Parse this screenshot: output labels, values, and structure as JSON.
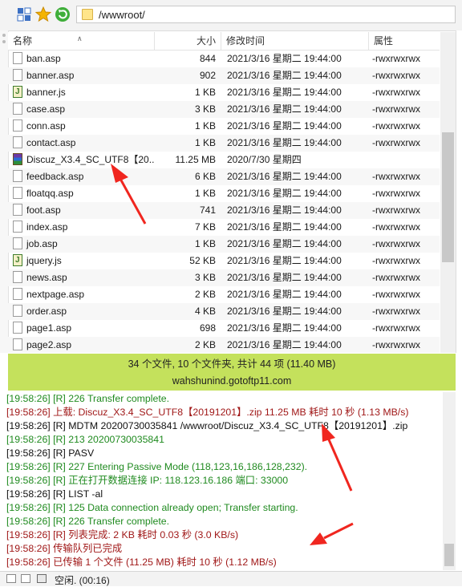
{
  "toolbar": {
    "path": "/wwwroot/"
  },
  "columns": {
    "name": "名称",
    "size": "大小",
    "modified": "修改时间",
    "attr": "属性"
  },
  "files": [
    {
      "name": "ban.asp",
      "size": "844",
      "date": "2021/3/16 星期二 19:44:00",
      "attr": "-rwxrwxrwx",
      "icon": "file-icon"
    },
    {
      "name": "banner.asp",
      "size": "902",
      "date": "2021/3/16 星期二 19:44:00",
      "attr": "-rwxrwxrwx",
      "icon": "file-icon"
    },
    {
      "name": "banner.js",
      "size": "1 KB",
      "date": "2021/3/16 星期二 19:44:00",
      "attr": "-rwxrwxrwx",
      "icon": "js-file-icon"
    },
    {
      "name": "case.asp",
      "size": "3 KB",
      "date": "2021/3/16 星期二 19:44:00",
      "attr": "-rwxrwxrwx",
      "icon": "file-icon"
    },
    {
      "name": "conn.asp",
      "size": "1 KB",
      "date": "2021/3/16 星期二 19:44:00",
      "attr": "-rwxrwxrwx",
      "icon": "file-icon"
    },
    {
      "name": "contact.asp",
      "size": "1 KB",
      "date": "2021/3/16 星期二 19:44:00",
      "attr": "-rwxrwxrwx",
      "icon": "file-icon"
    },
    {
      "name": "Discuz_X3.4_SC_UTF8【20...",
      "size": "11.25 MB",
      "date": "2020/7/30 星期四",
      "attr": "",
      "icon": "archive-icon"
    },
    {
      "name": "feedback.asp",
      "size": "6 KB",
      "date": "2021/3/16 星期二 19:44:00",
      "attr": "-rwxrwxrwx",
      "icon": "file-icon"
    },
    {
      "name": "floatqq.asp",
      "size": "1 KB",
      "date": "2021/3/16 星期二 19:44:00",
      "attr": "-rwxrwxrwx",
      "icon": "file-icon"
    },
    {
      "name": "foot.asp",
      "size": "741",
      "date": "2021/3/16 星期二 19:44:00",
      "attr": "-rwxrwxrwx",
      "icon": "file-icon"
    },
    {
      "name": "index.asp",
      "size": "7 KB",
      "date": "2021/3/16 星期二 19:44:00",
      "attr": "-rwxrwxrwx",
      "icon": "file-icon"
    },
    {
      "name": "job.asp",
      "size": "1 KB",
      "date": "2021/3/16 星期二 19:44:00",
      "attr": "-rwxrwxrwx",
      "icon": "file-icon"
    },
    {
      "name": "jquery.js",
      "size": "52 KB",
      "date": "2021/3/16 星期二 19:44:00",
      "attr": "-rwxrwxrwx",
      "icon": "js-file-icon"
    },
    {
      "name": "news.asp",
      "size": "3 KB",
      "date": "2021/3/16 星期二 19:44:00",
      "attr": "-rwxrwxrwx",
      "icon": "file-icon"
    },
    {
      "name": "nextpage.asp",
      "size": "2 KB",
      "date": "2021/3/16 星期二 19:44:00",
      "attr": "-rwxrwxrwx",
      "icon": "file-icon"
    },
    {
      "name": "order.asp",
      "size": "4 KB",
      "date": "2021/3/16 星期二 19:44:00",
      "attr": "-rwxrwxrwx",
      "icon": "file-icon"
    },
    {
      "name": "page1.asp",
      "size": "698",
      "date": "2021/3/16 星期二 19:44:00",
      "attr": "-rwxrwxrwx",
      "icon": "file-icon"
    },
    {
      "name": "page2.asp",
      "size": "2 KB",
      "date": "2021/3/16 星期二 19:44:00",
      "attr": "-rwxrwxrwx",
      "icon": "file-icon"
    }
  ],
  "status": {
    "summary": "34 个文件, 10 个文件夹, 共计 44 项 (11.40 MB)",
    "host": "wahshunind.gotoftp11.com"
  },
  "log": [
    {
      "text": "[19:58:26] [R] 226 Transfer complete.",
      "color": "green"
    },
    {
      "text": "[19:58:26] 上载: Discuz_X3.4_SC_UTF8【20191201】.zip 11.25 MB 耗时 10 秒 (1.13 MB/s)",
      "color": "red"
    },
    {
      "text": "[19:58:26] [R] MDTM 20200730035841 /wwwroot/Discuz_X3.4_SC_UTF8【20191201】.zip",
      "color": "black"
    },
    {
      "text": "[19:58:26] [R] 213 20200730035841",
      "color": "green"
    },
    {
      "text": "[19:58:26] [R] PASV",
      "color": "black"
    },
    {
      "text": "[19:58:26] [R] 227 Entering Passive Mode (118,123,16,186,128,232).",
      "color": "green"
    },
    {
      "text": "[19:58:26] [R] 正在打开数据连接 IP: 118.123.16.186 端口: 33000",
      "color": "green"
    },
    {
      "text": "[19:58:26] [R] LIST -al",
      "color": "black"
    },
    {
      "text": "[19:58:26] [R] 125 Data connection already open; Transfer starting.",
      "color": "green"
    },
    {
      "text": "[19:58:26] [R] 226 Transfer complete.",
      "color": "green"
    },
    {
      "text": "[19:58:26] [R] 列表完成: 2 KB 耗时 0.03 秒 (3.0 KB/s)",
      "color": "red"
    },
    {
      "text": "[19:58:26] 传输队列已完成",
      "color": "red"
    },
    {
      "text": "[19:58:26] 已传输 1 个文件 (11.25 MB) 耗时 10 秒 (1.12 MB/s)",
      "color": "red"
    }
  ],
  "bottom": {
    "status_text": "空闲. (00:16)"
  },
  "colors": {
    "status_bg": "#c4e15c",
    "log_green": "#1f8a1f",
    "log_red": "#a01818",
    "arrow": "#f0261f"
  }
}
